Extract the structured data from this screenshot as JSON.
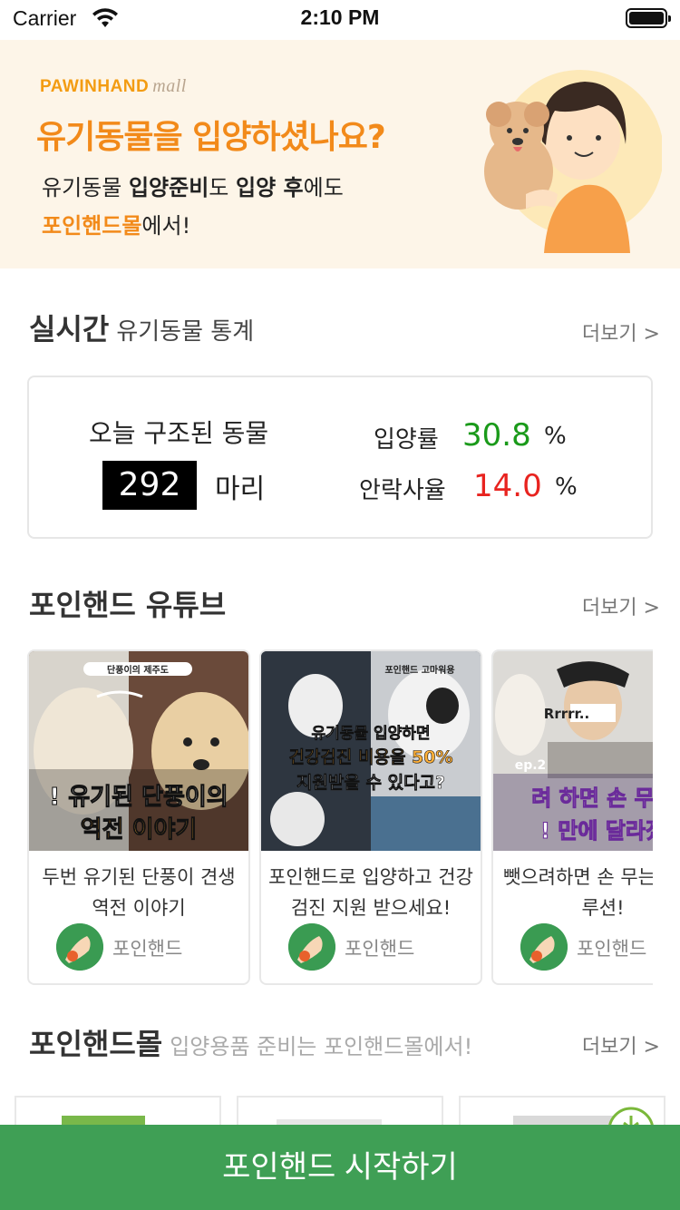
{
  "status_bar": {
    "carrier": "Carrier",
    "time": "2:10 PM"
  },
  "banner": {
    "brand": "PAWINHAND",
    "brand_suffix": "mall",
    "title": "유기동물을 입양하셨나요?",
    "line1_a": "유기동물 ",
    "line1_b": "입양준비",
    "line1_c": "도 ",
    "line1_d": "입양 후",
    "line1_e": "에도",
    "line2_highlight": "포인핸드몰",
    "line2_rest": "에서!"
  },
  "stats": {
    "title": "실시간",
    "subtitle": "유기동물 통계",
    "more": "더보기 >",
    "rescued_label": "오늘 구조된 동물",
    "rescued_count": "292",
    "rescued_unit": "마리",
    "adoption_label": "입양률",
    "adoption_value": "30.8",
    "euthanasia_label": "안락사율",
    "euthanasia_value": "14.0",
    "percent": "%",
    "colors": {
      "adoption": "#1a9a1a",
      "euthanasia": "#e8231f"
    }
  },
  "youtube": {
    "title": "포인핸드 유튜브",
    "more": "더보기 >",
    "videos": [
      {
        "caption": "두번 유기된 단풍이 견생 역전 이야기",
        "channel": "포인핸드",
        "thumb_line1": "! 유기된 단풍이의",
        "thumb_line2": "역전 이야기",
        "thumb_tag": "단풍이의 제주도"
      },
      {
        "caption": "포인핸드로 입양하고 건강검진 지원 받으세요!",
        "channel": "포인핸드",
        "thumb_line1": "유기동물 입양하면",
        "thumb_line2": "건강검진 비용을 50%",
        "thumb_line3": "지원받을 수 있다고?",
        "thumb_tag": "포인핸드 고마워용"
      },
      {
        "caption": "뺏으려하면 손 무는 지 솔루션!",
        "channel": "포인핸드",
        "thumb_line1": "려 하면 손 무는",
        "thumb_line2": "! 만에 달라졌",
        "thumb_tag": "Rrrrr..",
        "thumb_ep": "ep.2"
      }
    ]
  },
  "mall": {
    "title": "포인핸드몰",
    "subtitle": "입양용품 준비는 포인핸드몰에서!",
    "more": "더보기 >"
  },
  "cta": {
    "label": "포인핸드 시작하기"
  }
}
